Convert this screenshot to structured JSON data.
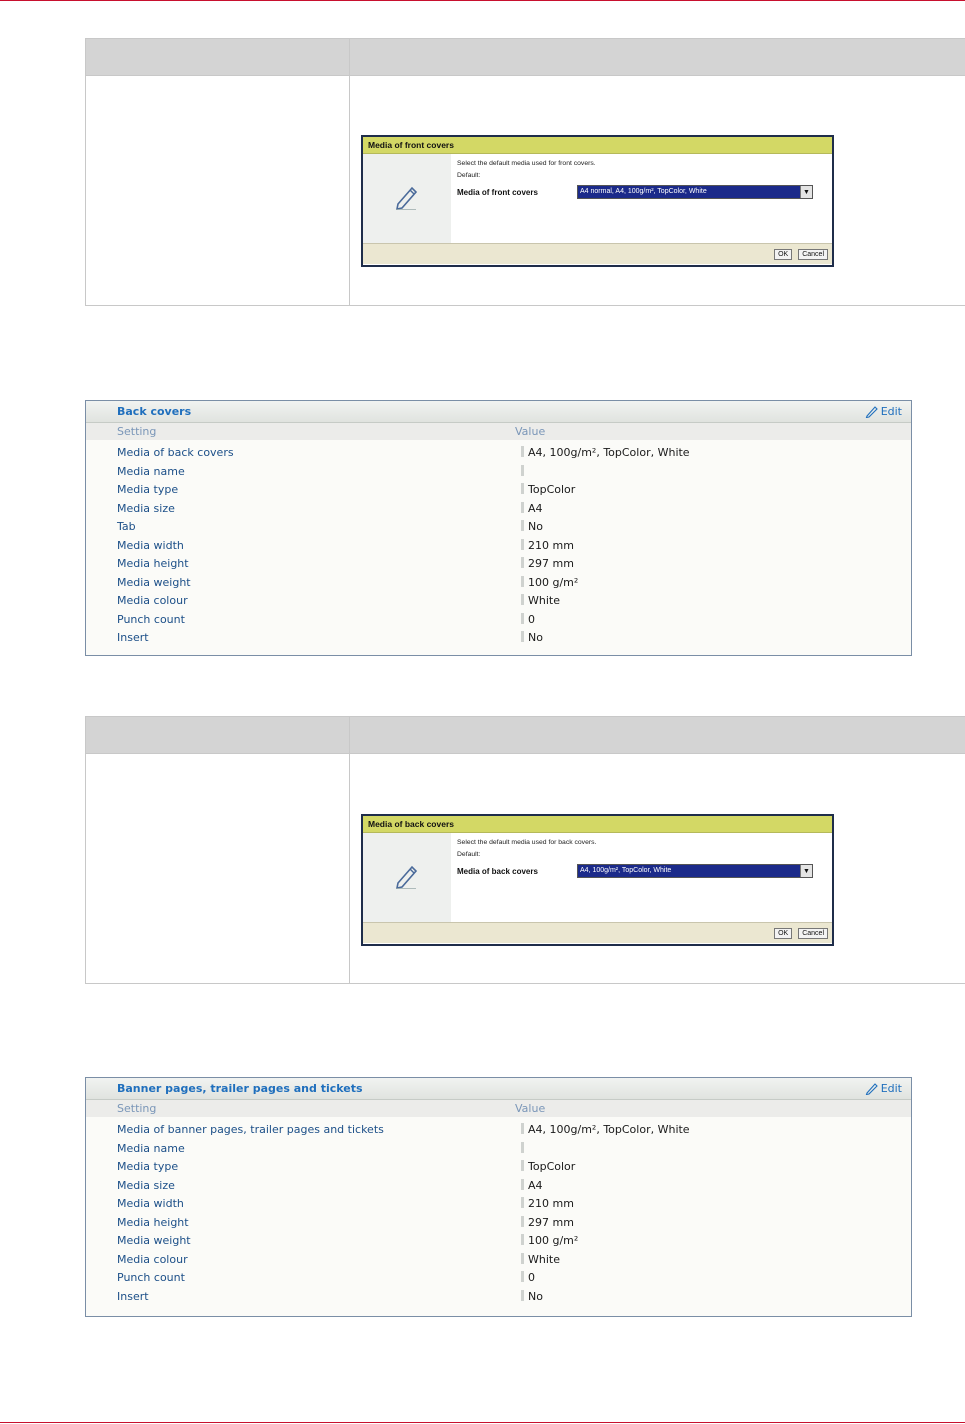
{
  "front_dialog": {
    "title": "Media of front covers",
    "description": "Select the default media used for front covers.",
    "default_label": "Default:",
    "field_label": "Media of front covers",
    "selected_value": "A4 normal, A4, 100g/m², TopColor, White",
    "ok_label": "OK",
    "cancel_label": "Cancel"
  },
  "back_panel": {
    "title": "Back covers",
    "edit_label": "Edit",
    "col_setting": "Setting",
    "col_value": "Value",
    "rows": [
      {
        "setting": "Media of back covers",
        "value": "A4, 100g/m², TopColor, White"
      },
      {
        "setting": "Media name",
        "value": ""
      },
      {
        "setting": "Media type",
        "value": "TopColor"
      },
      {
        "setting": "Media size",
        "value": "A4"
      },
      {
        "setting": "Tab",
        "value": "No"
      },
      {
        "setting": "Media width",
        "value": "210 mm"
      },
      {
        "setting": "Media height",
        "value": "297 mm"
      },
      {
        "setting": "Media weight",
        "value": "100 g/m²"
      },
      {
        "setting": "Media colour",
        "value": "White"
      },
      {
        "setting": "Punch count",
        "value": "0"
      },
      {
        "setting": "Insert",
        "value": "No"
      }
    ]
  },
  "back_dialog": {
    "title": "Media of back covers",
    "description": "Select the default media used for back covers.",
    "default_label": "Default:",
    "field_label": "Media of back covers",
    "selected_value": "A4, 100g/m², TopColor, White",
    "ok_label": "OK",
    "cancel_label": "Cancel"
  },
  "banner_panel": {
    "title": "Banner pages, trailer pages and tickets",
    "edit_label": "Edit",
    "col_setting": "Setting",
    "col_value": "Value",
    "rows": [
      {
        "setting": "Media of banner pages, trailer pages and tickets",
        "value": "A4, 100g/m², TopColor, White"
      },
      {
        "setting": "Media name",
        "value": ""
      },
      {
        "setting": "Media type",
        "value": "TopColor"
      },
      {
        "setting": "Media size",
        "value": "A4"
      },
      {
        "setting": "Media width",
        "value": "210 mm"
      },
      {
        "setting": "Media height",
        "value": "297 mm"
      },
      {
        "setting": "Media weight",
        "value": "100 g/m²"
      },
      {
        "setting": "Media colour",
        "value": "White"
      },
      {
        "setting": "Punch count",
        "value": "0"
      },
      {
        "setting": "Insert",
        "value": "No"
      }
    ]
  },
  "colors": {
    "accent_blue": "#1f6fbd",
    "dialog_title_bar": "#d3d865",
    "page_rule": "#c8102e"
  }
}
